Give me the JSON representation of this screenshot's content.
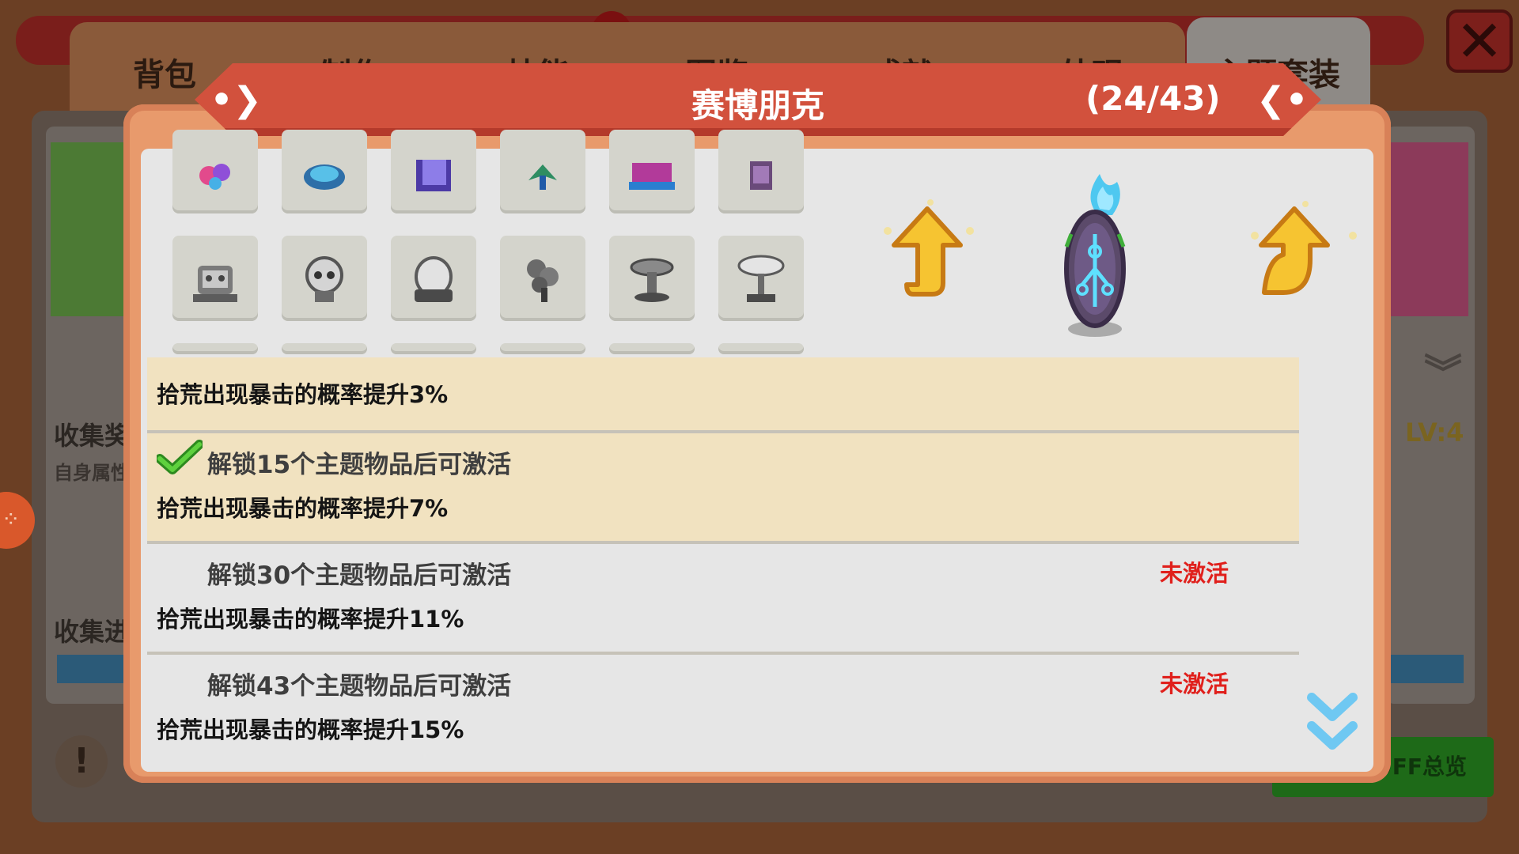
{
  "background": {
    "tabs": [
      "背包",
      "制作",
      "技能",
      "图鉴",
      "成就",
      "外观",
      "主题套装"
    ],
    "collect_label_1": "收集奖",
    "self_attr_label": "自身属性",
    "collect_label_2": "收集进",
    "level_label": "LV:4",
    "buff_button_label": "BUFF总览",
    "close_icon": "close-icon"
  },
  "modal": {
    "title": "赛博朋克",
    "count": "(24/43)",
    "prev_icon": "arrow-left-icon",
    "next_icon": "arrow-right-icon",
    "preview": {
      "upgrade_icons": [
        "upgrade-arrow-icon",
        "upgrade-arrow-icon"
      ],
      "center_item": "cyber-shield-icon"
    },
    "items": {
      "row_top": [
        "flower-item",
        "helmet-item",
        "crate-item",
        "plant-item",
        "bench-item",
        "box-item"
      ],
      "row_middle": [
        "robot-statue",
        "skull-statue",
        "dome-statue",
        "tree-statue",
        "table-statue",
        "lamp-statue"
      ],
      "row_bottom_partial": 6
    },
    "bonuses": [
      {
        "condition": "",
        "effect": "拾荒出现暴击的概率提升3%",
        "status": "",
        "active": true,
        "checked": false
      },
      {
        "condition": "解锁15个主题物品后可激活",
        "effect": "拾荒出现暴击的概率提升7%",
        "status": "",
        "active": true,
        "checked": true
      },
      {
        "condition": "解锁30个主题物品后可激活",
        "effect": "拾荒出现暴击的概率提升11%",
        "status": "未激活",
        "active": false,
        "checked": false
      },
      {
        "condition": "解锁43个主题物品后可激活",
        "effect": "拾荒出现暴击的概率提升15%",
        "status": "未激活",
        "active": false,
        "checked": false
      }
    ],
    "colors": {
      "ribbon": "#d2513d",
      "frame": "#e89a6c",
      "active_row": "#f1e2c0",
      "inactive_status": "#e0201c",
      "check": "#3ea82a",
      "flame": "#4ec8f0"
    }
  }
}
